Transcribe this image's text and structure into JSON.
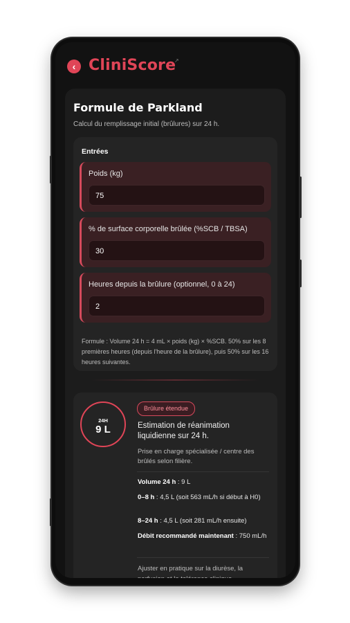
{
  "app": {
    "name": "CliniScore",
    "back_icon": "chevron-left-icon",
    "accent": "#e04557"
  },
  "calculator": {
    "title": "Formule de Parkland",
    "subtitle": "Calcul du remplissage initial (brûlures) sur 24 h."
  },
  "inputs": {
    "section_title": "Entrées",
    "fields": [
      {
        "label": "Poids (kg)",
        "value": "75"
      },
      {
        "label": "% de surface corporelle brûlée (%SCB / TBSA)",
        "value": "30"
      },
      {
        "label": "Heures depuis la brûlure (optionnel, 0 à 24)",
        "value": "2"
      }
    ],
    "formula": "Formule : Volume 24 h = 4 mL × poids (kg) × %SCB. 50% sur les 8 premières heures (depuis l'heure de la brûlure), puis 50% sur les 16 heures suivantes."
  },
  "result": {
    "gauge_label": "24H",
    "gauge_value": "9 L",
    "badge": "Brûlure étendue",
    "description": "Estimation de réanimation liquidienne sur 24 h.",
    "note": "Prise en charge spécialisée / centre des brûlés selon filière.",
    "details": [
      {
        "label": "Volume 24 h",
        "value": " : 9 L"
      },
      {
        "label": "0–8 h",
        "value": " : 4,5 L (soit 563 mL/h si début à H0)"
      },
      {
        "label": "8–24 h",
        "value": " : 4,5 L (soit 281 mL/h ensuite)"
      },
      {
        "label": "Débit recommandé maintenant",
        "value": " : 750 mL/h"
      }
    ],
    "footer": "Ajuster en pratique sur la diurèse, la perfusion et la tolérance clinique."
  }
}
